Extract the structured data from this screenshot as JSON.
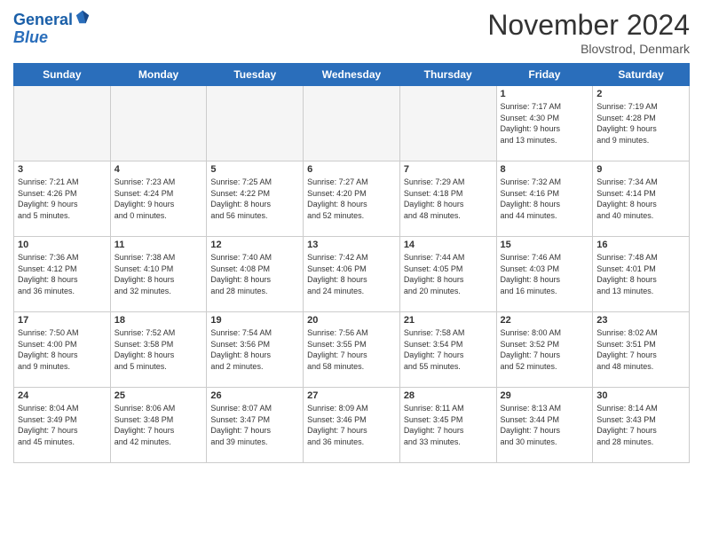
{
  "header": {
    "logo_line1": "General",
    "logo_line2": "Blue",
    "month_title": "November 2024",
    "subtitle": "Blovstrod, Denmark"
  },
  "days_of_week": [
    "Sunday",
    "Monday",
    "Tuesday",
    "Wednesday",
    "Thursday",
    "Friday",
    "Saturday"
  ],
  "weeks": [
    [
      {
        "day": "",
        "info": ""
      },
      {
        "day": "",
        "info": ""
      },
      {
        "day": "",
        "info": ""
      },
      {
        "day": "",
        "info": ""
      },
      {
        "day": "",
        "info": ""
      },
      {
        "day": "1",
        "info": "Sunrise: 7:17 AM\nSunset: 4:30 PM\nDaylight: 9 hours\nand 13 minutes."
      },
      {
        "day": "2",
        "info": "Sunrise: 7:19 AM\nSunset: 4:28 PM\nDaylight: 9 hours\nand 9 minutes."
      }
    ],
    [
      {
        "day": "3",
        "info": "Sunrise: 7:21 AM\nSunset: 4:26 PM\nDaylight: 9 hours\nand 5 minutes."
      },
      {
        "day": "4",
        "info": "Sunrise: 7:23 AM\nSunset: 4:24 PM\nDaylight: 9 hours\nand 0 minutes."
      },
      {
        "day": "5",
        "info": "Sunrise: 7:25 AM\nSunset: 4:22 PM\nDaylight: 8 hours\nand 56 minutes."
      },
      {
        "day": "6",
        "info": "Sunrise: 7:27 AM\nSunset: 4:20 PM\nDaylight: 8 hours\nand 52 minutes."
      },
      {
        "day": "7",
        "info": "Sunrise: 7:29 AM\nSunset: 4:18 PM\nDaylight: 8 hours\nand 48 minutes."
      },
      {
        "day": "8",
        "info": "Sunrise: 7:32 AM\nSunset: 4:16 PM\nDaylight: 8 hours\nand 44 minutes."
      },
      {
        "day": "9",
        "info": "Sunrise: 7:34 AM\nSunset: 4:14 PM\nDaylight: 8 hours\nand 40 minutes."
      }
    ],
    [
      {
        "day": "10",
        "info": "Sunrise: 7:36 AM\nSunset: 4:12 PM\nDaylight: 8 hours\nand 36 minutes."
      },
      {
        "day": "11",
        "info": "Sunrise: 7:38 AM\nSunset: 4:10 PM\nDaylight: 8 hours\nand 32 minutes."
      },
      {
        "day": "12",
        "info": "Sunrise: 7:40 AM\nSunset: 4:08 PM\nDaylight: 8 hours\nand 28 minutes."
      },
      {
        "day": "13",
        "info": "Sunrise: 7:42 AM\nSunset: 4:06 PM\nDaylight: 8 hours\nand 24 minutes."
      },
      {
        "day": "14",
        "info": "Sunrise: 7:44 AM\nSunset: 4:05 PM\nDaylight: 8 hours\nand 20 minutes."
      },
      {
        "day": "15",
        "info": "Sunrise: 7:46 AM\nSunset: 4:03 PM\nDaylight: 8 hours\nand 16 minutes."
      },
      {
        "day": "16",
        "info": "Sunrise: 7:48 AM\nSunset: 4:01 PM\nDaylight: 8 hours\nand 13 minutes."
      }
    ],
    [
      {
        "day": "17",
        "info": "Sunrise: 7:50 AM\nSunset: 4:00 PM\nDaylight: 8 hours\nand 9 minutes."
      },
      {
        "day": "18",
        "info": "Sunrise: 7:52 AM\nSunset: 3:58 PM\nDaylight: 8 hours\nand 5 minutes."
      },
      {
        "day": "19",
        "info": "Sunrise: 7:54 AM\nSunset: 3:56 PM\nDaylight: 8 hours\nand 2 minutes."
      },
      {
        "day": "20",
        "info": "Sunrise: 7:56 AM\nSunset: 3:55 PM\nDaylight: 7 hours\nand 58 minutes."
      },
      {
        "day": "21",
        "info": "Sunrise: 7:58 AM\nSunset: 3:54 PM\nDaylight: 7 hours\nand 55 minutes."
      },
      {
        "day": "22",
        "info": "Sunrise: 8:00 AM\nSunset: 3:52 PM\nDaylight: 7 hours\nand 52 minutes."
      },
      {
        "day": "23",
        "info": "Sunrise: 8:02 AM\nSunset: 3:51 PM\nDaylight: 7 hours\nand 48 minutes."
      }
    ],
    [
      {
        "day": "24",
        "info": "Sunrise: 8:04 AM\nSunset: 3:49 PM\nDaylight: 7 hours\nand 45 minutes."
      },
      {
        "day": "25",
        "info": "Sunrise: 8:06 AM\nSunset: 3:48 PM\nDaylight: 7 hours\nand 42 minutes."
      },
      {
        "day": "26",
        "info": "Sunrise: 8:07 AM\nSunset: 3:47 PM\nDaylight: 7 hours\nand 39 minutes."
      },
      {
        "day": "27",
        "info": "Sunrise: 8:09 AM\nSunset: 3:46 PM\nDaylight: 7 hours\nand 36 minutes."
      },
      {
        "day": "28",
        "info": "Sunrise: 8:11 AM\nSunset: 3:45 PM\nDaylight: 7 hours\nand 33 minutes."
      },
      {
        "day": "29",
        "info": "Sunrise: 8:13 AM\nSunset: 3:44 PM\nDaylight: 7 hours\nand 30 minutes."
      },
      {
        "day": "30",
        "info": "Sunrise: 8:14 AM\nSunset: 3:43 PM\nDaylight: 7 hours\nand 28 minutes."
      }
    ]
  ]
}
